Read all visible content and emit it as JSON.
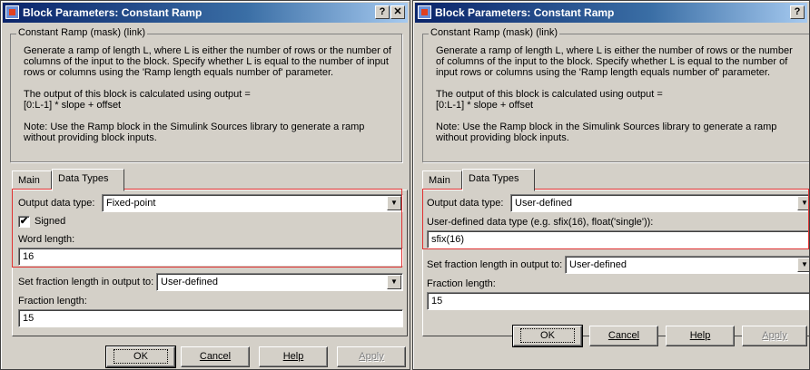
{
  "windows": [
    {
      "title": "Block Parameters: Constant Ramp",
      "help_glyph": "?",
      "close_glyph": "✕",
      "group_label": "Constant Ramp (mask) (link)",
      "description": [
        "Generate a ramp of length L, where L is either the number of rows or the number of columns of the input to the block.  Specify whether L is equal to the number of input rows or columns using the 'Ramp length equals number of' parameter.",
        "The output of this block is calculated using output = [0:L-1] * slope + offset",
        "Note: Use the Ramp block in the Simulink Sources library to generate a ramp without providing block inputs."
      ],
      "tabs": [
        "Main",
        "Data Types"
      ],
      "active_tab": "Data Types",
      "output_data_type_label": "Output data type:",
      "output_data_type_value": "Fixed-point",
      "signed_label": "Signed",
      "signed_checked": "✔",
      "word_length_label": "Word length:",
      "word_length_value": "16",
      "fraction_mode_label": "Set fraction length in output to:",
      "fraction_mode_value": "User-defined",
      "fraction_length_label": "Fraction length:",
      "fraction_length_value": "15",
      "buttons": {
        "ok": "OK",
        "cancel": "Cancel",
        "help": "Help",
        "apply": "Apply"
      }
    },
    {
      "title": "Block Parameters: Constant Ramp",
      "help_glyph": "?",
      "close_glyph": "✕",
      "group_label": "Constant Ramp (mask) (link)",
      "description": [
        "Generate a ramp of length L, where L is either the number of rows or the number of columns of the input to the block.  Specify whether L is equal to the number of input rows or columns using the 'Ramp length equals number of' parameter.",
        "The output of this block is calculated using output = [0:L-1] * slope + offset",
        "Note: Use the Ramp block in the Simulink Sources library to generate a ramp without providing block inputs."
      ],
      "tabs": [
        "Main",
        "Data Types"
      ],
      "active_tab": "Data Types",
      "output_data_type_label": "Output data type:",
      "output_data_type_value": "User-defined",
      "user_defined_label": "User-defined data type (e.g. sfix(16), float('single')):",
      "user_defined_value": "sfix(16)",
      "fraction_mode_label": "Set fraction length in output to:",
      "fraction_mode_value": "User-defined",
      "fraction_length_label": "Fraction length:",
      "fraction_length_value": "15",
      "buttons": {
        "ok": "OK",
        "cancel": "Cancel",
        "help": "Help",
        "apply": "Apply"
      }
    }
  ],
  "icons": {
    "app": "simulink-block-icon",
    "dropdown": "chevron-down-icon",
    "check": "checkmark-icon"
  },
  "colors": {
    "titlebar_start": "#0a246a",
    "titlebar_end": "#a6caf0",
    "face": "#d4d0c8",
    "highlight_box": "#e03030"
  }
}
